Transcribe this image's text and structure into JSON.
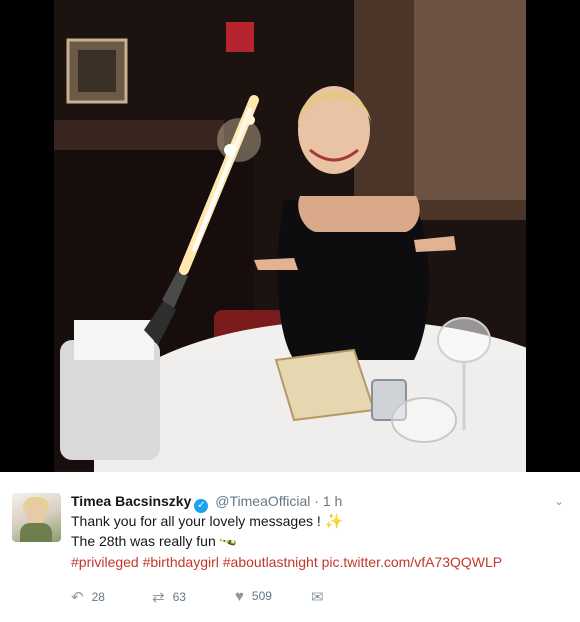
{
  "tweet": {
    "display_name": "Timea Bacsinszky",
    "handle": "@TimeaOfficial",
    "separator": "·",
    "time": "1 h",
    "line1": "Thank you for all your lovely messages !",
    "line2": "The 28th was really fun",
    "hashtags": "#privileged #birthdaygirl #aboutlastnight",
    "pic_link": "pic.twitter.com/vfA73QQWLP",
    "reply_count": "28",
    "retweet_count": "63",
    "like_count": "509"
  },
  "icons": {
    "verified": "verified-badge-icon",
    "chevron": "chevron-down-icon",
    "sparkle": "sparkles-emoji",
    "bottle": "champagne-bottle-emoji",
    "reply": "reply-icon",
    "retweet": "retweet-icon",
    "like": "heart-icon",
    "dm": "envelope-icon"
  },
  "colors": {
    "link": "#c0392b",
    "verified": "#1da1f2",
    "muted": "#657786"
  }
}
